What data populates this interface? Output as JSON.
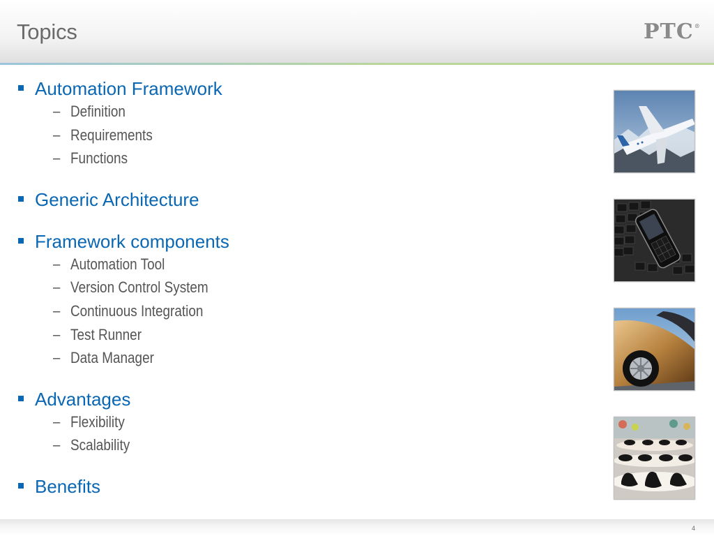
{
  "slide": {
    "title": "Topics",
    "logo_text": "PTC",
    "logo_mark": "®",
    "page_number": "4"
  },
  "topics": [
    {
      "label": "Automation Framework",
      "subs": [
        "Definition",
        "Requirements",
        "Functions"
      ]
    },
    {
      "label": "Generic Architecture",
      "subs": []
    },
    {
      "label": "Framework components",
      "subs": [
        "Automation Tool",
        "Version Control System",
        "Continuous Integration",
        "Test Runner",
        "Data Manager"
      ]
    },
    {
      "label": "Advantages",
      "subs": [
        "Flexibility",
        "Scalability"
      ]
    },
    {
      "label": "Benefits",
      "subs": []
    }
  ],
  "dash_glyph": "–",
  "images": [
    {
      "name": "airplane-photo"
    },
    {
      "name": "phone-on-keyboard-photo"
    },
    {
      "name": "car-wheel-photo"
    },
    {
      "name": "shoes-display-photo"
    }
  ],
  "colors": {
    "topic_text": "#0a67b4",
    "sub_text": "#555555",
    "title_text": "#6a6a6a"
  }
}
